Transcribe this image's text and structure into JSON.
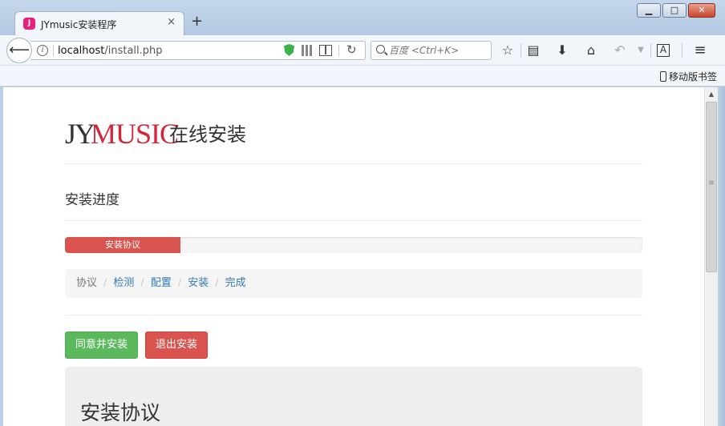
{
  "browser": {
    "tab_title": "JYmusic安装程序",
    "tab_favicon_text": "J",
    "tab_close": "×",
    "new_tab": "+",
    "url_prefix": "localhost",
    "url_path": "/install.php",
    "search_placeholder": "百度 <Ctrl+K>",
    "bookmark_label": "移动版书签",
    "window_buttons": {
      "minimize": "▁",
      "maximize": "□",
      "close": "✕"
    }
  },
  "page": {
    "logo_jy": "JY",
    "logo_music": "MUSIC",
    "logo_suffix": "在线安装",
    "progress_title": "安装进度",
    "progress": {
      "label": "安装协议",
      "percent": 20,
      "color": "#d9534f"
    },
    "breadcrumb": [
      {
        "label": "协议",
        "active": true
      },
      {
        "label": "检测",
        "active": false
      },
      {
        "label": "配置",
        "active": false
      },
      {
        "label": "安装",
        "active": false
      },
      {
        "label": "完成",
        "active": false
      }
    ],
    "buttons": {
      "agree": "同意并安装",
      "exit": "退出安装"
    },
    "agreement_title": "安装协议"
  },
  "colors": {
    "success": "#5cb85c",
    "danger": "#d9534f",
    "link": "#337ab7",
    "brand": "#d4263a"
  }
}
